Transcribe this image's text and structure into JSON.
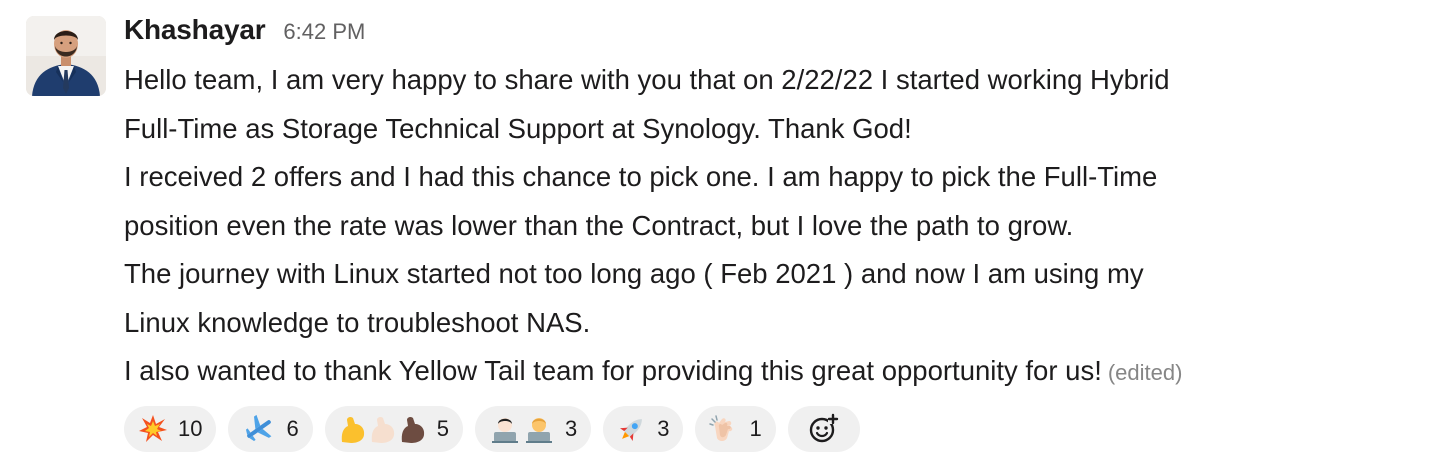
{
  "message": {
    "author": "Khashayar",
    "time": "6:42 PM",
    "lines": [
      "Hello team, I am very happy to share with you that on 2/22/22 I started working Hybrid",
      "Full-Time as Storage Technical Support at Synology. Thank God!",
      "I received 2 offers and I had this chance to pick one. I am happy to pick the Full-Time",
      "position even the rate was lower than the Contract, but I love the path to grow.",
      "The journey with Linux started not too long ago ( Feb 2021 ) and now I am using my",
      "Linux knowledge to troubleshoot NAS.",
      "I also wanted to thank Yellow Tail team for providing this great opportunity for us!"
    ],
    "edited_label": "(edited)"
  },
  "reactions": [
    {
      "emoji": "collision-icon",
      "count": "10"
    },
    {
      "emoji": "airplane-icon",
      "count": "6"
    },
    {
      "emoji": "flexed-biceps-skin-tones-icon",
      "count": "5"
    },
    {
      "emoji": "technologists-icon",
      "count": "3"
    },
    {
      "emoji": "rocket-icon",
      "count": "3"
    },
    {
      "emoji": "clapping-hands-icon",
      "count": "1"
    }
  ],
  "colors": {
    "text": "#1d1c1d",
    "muted": "#616061",
    "edited": "#868686",
    "reaction_bg": "#f0f0f0"
  }
}
